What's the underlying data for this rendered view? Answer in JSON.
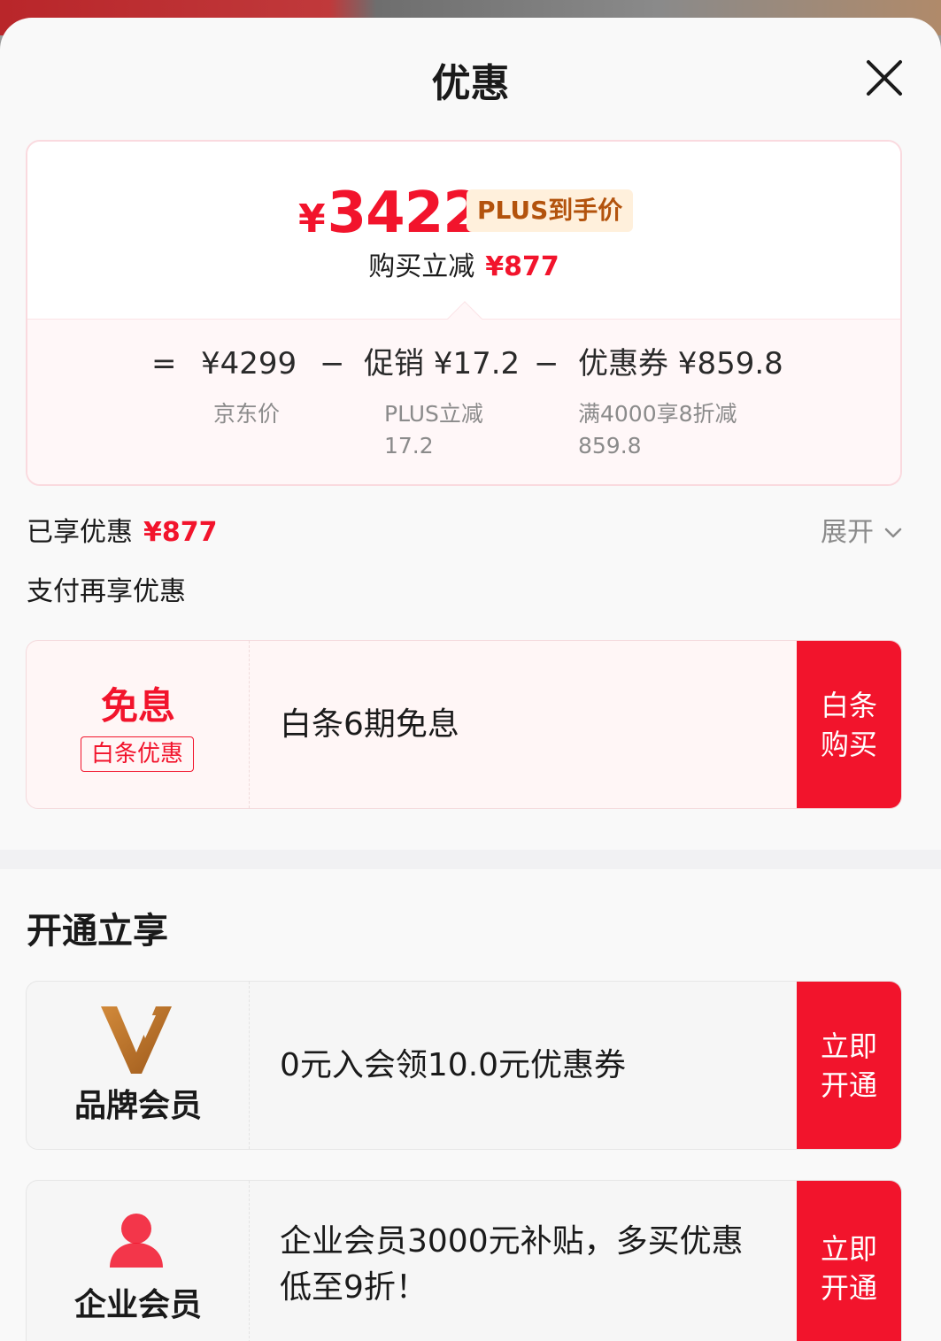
{
  "sheet": {
    "title": "优惠"
  },
  "price_card": {
    "currency": "¥",
    "final_price": "3422",
    "plus_tag": "PLUS到手价",
    "buy_reduce_label": "购买立减",
    "buy_reduce_value": "¥877",
    "formula": {
      "equals": "=",
      "jd_price": "¥4299",
      "minus1": "−",
      "promo": "促销 ¥17.2",
      "minus2": "−",
      "coupon": "优惠券 ¥859.8",
      "jd_price_label": "京东价",
      "promo_label_line1": "PLUS立减",
      "promo_label_line2": "17.2",
      "coupon_label_line1": "满4000享8折减",
      "coupon_label_line2": "859.8"
    }
  },
  "enjoyed": {
    "label": "已享优惠",
    "value": "¥877",
    "expand_label": "展开"
  },
  "pay_section": {
    "title": "支付再享优惠"
  },
  "baitiao_offer": {
    "badge_title": "免息",
    "badge_tag": "白条优惠",
    "description": "白条6期免息",
    "action_line1": "白条",
    "action_line2": "购买"
  },
  "membership_section": {
    "title": "开通立享"
  },
  "brand_member": {
    "icon": "brand-v-logo",
    "name": "品牌会员",
    "description": "0元入会领10.0元优惠券",
    "action_line1": "立即",
    "action_line2": "开通"
  },
  "enterprise_member": {
    "icon": "person-icon",
    "name": "企业会员",
    "description_line1": "企业会员3000元补贴，多买优惠",
    "description_line2": "低至9折！",
    "action_line1": "立即",
    "action_line2": "开通"
  },
  "colors": {
    "accent_red": "#f2142c",
    "plus_tag_bg": "#fff0dc",
    "plus_tag_text": "#b3530d",
    "brand_gold": "#c57a2c"
  }
}
